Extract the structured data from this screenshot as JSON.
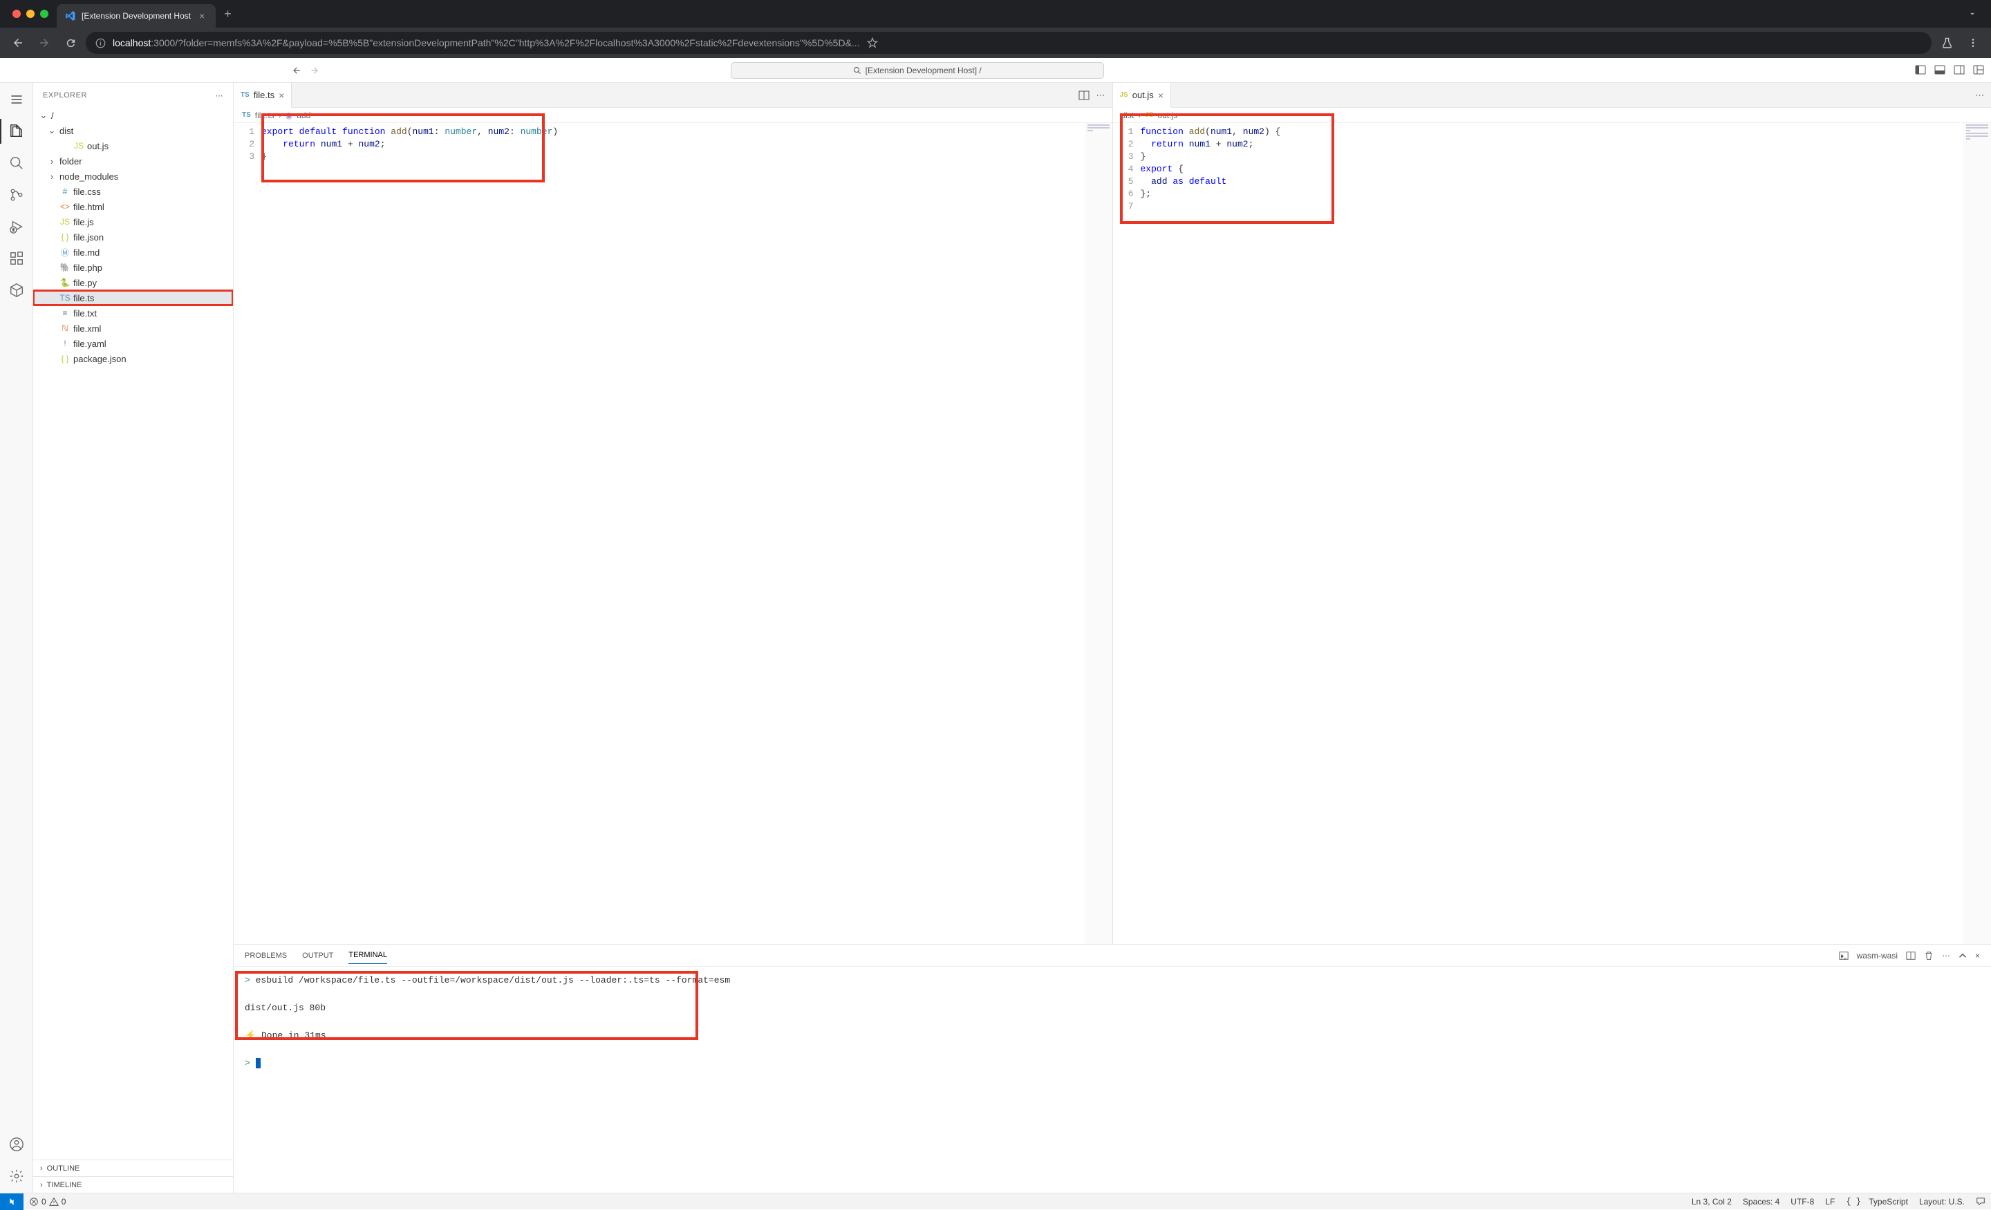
{
  "browser": {
    "tab_title": "[Extension Development Host",
    "url_host": "localhost",
    "url_rest": ":3000/?folder=memfs%3A%2F&payload=%5B%5B\"extensionDevelopmentPath\"%2C\"http%3A%2F%2Flocalhost%3A3000%2Fstatic%2Fdevextensions\"%5D%5D&..."
  },
  "vscode": {
    "command_center": "[Extension Development Host] /",
    "explorer_title": "EXPLORER",
    "sections": {
      "outline": "OUTLINE",
      "timeline": "TIMELINE"
    },
    "tree": {
      "root": "/",
      "items": [
        {
          "label": "dist",
          "type": "folder",
          "expanded": true,
          "children": [
            {
              "label": "out.js",
              "icon": "js"
            }
          ]
        },
        {
          "label": "folder",
          "type": "folder",
          "expanded": false
        },
        {
          "label": "node_modules",
          "type": "folder",
          "expanded": false
        },
        {
          "label": "file.css",
          "icon": "css"
        },
        {
          "label": "file.html",
          "icon": "html"
        },
        {
          "label": "file.js",
          "icon": "js"
        },
        {
          "label": "file.json",
          "icon": "json"
        },
        {
          "label": "file.md",
          "icon": "md"
        },
        {
          "label": "file.php",
          "icon": "php"
        },
        {
          "label": "file.py",
          "icon": "py"
        },
        {
          "label": "file.ts",
          "icon": "ts",
          "selected": true,
          "highlighted": true
        },
        {
          "label": "file.txt",
          "icon": "txt"
        },
        {
          "label": "file.xml",
          "icon": "xml"
        },
        {
          "label": "file.yaml",
          "icon": "yaml"
        },
        {
          "label": "package.json",
          "icon": "json"
        }
      ]
    },
    "editor_left": {
      "tab_label": "file.ts",
      "tab_icon": "TS",
      "breadcrumb": [
        "file.ts",
        "add"
      ],
      "lines": [
        "export default function add(num1: number, num2: number)",
        "    return num1 + num2;",
        "}"
      ]
    },
    "editor_right": {
      "tab_label": "out.js",
      "tab_icon": "JS",
      "breadcrumb": [
        "dist",
        "out.js"
      ],
      "lines": [
        "function add(num1, num2) {",
        "  return num1 + num2;",
        "}",
        "export {",
        "  add as default",
        "};",
        ""
      ]
    },
    "panel": {
      "tabs": {
        "problems": "PROBLEMS",
        "output": "OUTPUT",
        "terminal": "TERMINAL"
      },
      "terminal_kind": "wasm-wasi",
      "lines": [
        "> esbuild /workspace/file.ts --outfile=/workspace/dist/out.js --loader:.ts=ts --format=esm",
        "",
        "  dist/out.js  80b",
        "",
        "⚡ Done in 31ms",
        "",
        "> "
      ]
    },
    "status": {
      "errors": "0",
      "warnings": "0",
      "ln_col": "Ln 3, Col 2",
      "spaces": "Spaces: 4",
      "encoding": "UTF-8",
      "eol": "LF",
      "lang": "TypeScript",
      "layout": "Layout: U.S."
    }
  }
}
